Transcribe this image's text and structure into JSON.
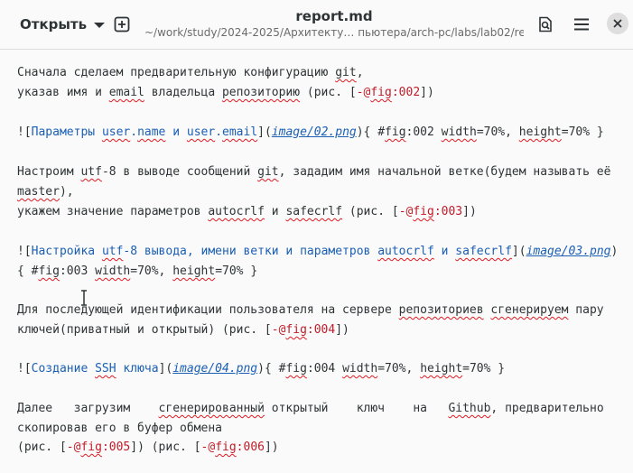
{
  "header": {
    "open_label": "Открыть",
    "title": "report.md",
    "subtitle": "~/work/study/2024-2025/Архитекту… пьютера/arch-pc/labs/lab02/report"
  },
  "icons": {
    "open_menu": "chevron-down-icon",
    "new_tab": "new-tab-icon",
    "search": "document-search-icon",
    "menu": "hamburger-menu-icon",
    "close": "close-icon"
  },
  "editor": {
    "l1": {
      "a": "Сначала сделаем предварительную конфигурацию ",
      "b": "git",
      "c": ","
    },
    "l2": {
      "a": "указав имя и ",
      "b": "email",
      "c": " владельца ",
      "d": "репозиторию",
      "e": " (рис. [",
      "f": "-@",
      "g": "fig",
      "h": ":002",
      "i": "])"
    },
    "l3": {
      "a": "![",
      "b": "Параметры ",
      "c": "user",
      "d": ".",
      "e": "name",
      "f": " и ",
      "g": "user",
      "h": ".",
      "i": "email",
      "j": "](",
      "k": "image/02.png",
      "l": "){ #",
      "m": "fig",
      "n": ":002 ",
      "o": "width",
      "p": "=70%, ",
      "q": "height",
      "r": "=70% }"
    },
    "l4": {
      "a": "Настроим ",
      "b": "utf",
      "c": "-8 в выводе сообщений ",
      "d": "git",
      "e": ", зададим имя начальной ветке(будем называть её"
    },
    "l5": {
      "a": "master",
      "b": "),"
    },
    "l6": {
      "a": "укажем значение параметров ",
      "b": "autocrlf",
      "c": " и ",
      "d": "safecrlf",
      "e": " (рис. [",
      "f": "-@",
      "g": "fig",
      "h": ":003",
      "i": "])"
    },
    "l7": {
      "a": "![",
      "b": "Настройка ",
      "c": "utf",
      "d": "-8 вывода, имени ветки и параметров ",
      "e": "autocrlf",
      "f": " и ",
      "g": "safecrlf",
      "h": "](",
      "i": "image/03.png",
      "j": ")"
    },
    "l8": {
      "a": "{ #",
      "b": "fig",
      "c": ":003 ",
      "d": "width",
      "e": "=70%, ",
      "f": "height",
      "g": "=70% }"
    },
    "l9": {
      "a": "Для последующей идентификации пользователя на сервере ",
      "b": "репозиториев",
      "c": " ",
      "d": "сгенерируем",
      "e": " пару"
    },
    "l10": {
      "a": "ключей(приватный и открытый) (рис. [",
      "b": "-@",
      "c": "fig",
      "d": ":004",
      "e": "])"
    },
    "l11": {
      "a": "![",
      "b": "Создание ",
      "c": "SSH",
      "d": " ключа",
      "e": "](",
      "f": "image/04.png",
      "g": "){ #",
      "h": "fig",
      "i": ":004 ",
      "j": "width",
      "k": "=70%, ",
      "l": "height",
      "m": "=70% }"
    },
    "l12": {
      "a": "Далее   загрузим    ",
      "b": "сгенерированный",
      "c": " открытый    ключ    на   ",
      "d": "Github",
      "e": ", предварительно"
    },
    "l13": {
      "a": "скопировав его в буфер обмена"
    },
    "l14": {
      "a": "(рис. [",
      "b": "-@",
      "c": "fig",
      "d": ":005",
      "e": "]) (рис. [",
      "f": "-@",
      "g": "fig",
      "h": ":006",
      "i": "])"
    }
  }
}
